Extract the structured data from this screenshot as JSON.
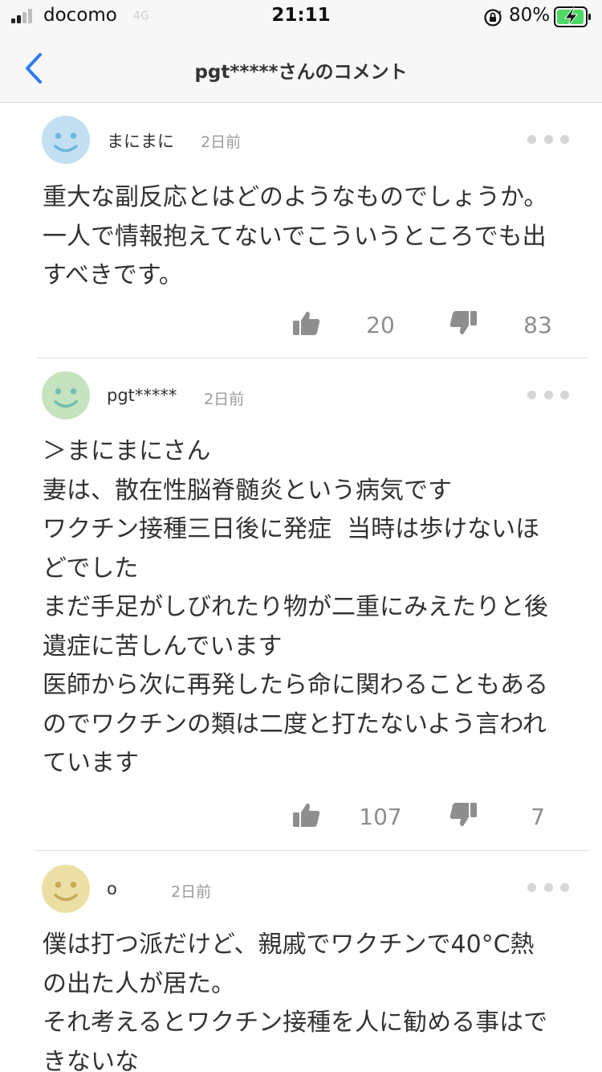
{
  "status_bar": {
    "carrier": "docomo",
    "network": "4G",
    "time": "21:11",
    "battery": "80%"
  },
  "header": {
    "title": "pgt*****さんのコメント",
    "back_icon": "chevron-left-icon",
    "accent_color": "#2e7bf6"
  },
  "comments": [
    {
      "user": "まにまに",
      "time": "2日前",
      "avatar_color": "#c3e0f2",
      "avatar_face_color": "#6fb6de",
      "lines": [
        "重大な副反応とはどのようなものでしょうか。",
        "一人で情報抱えてないでこういうところでも出",
        "すべきです。"
      ],
      "likes": "20",
      "dislikes": "83"
    },
    {
      "user": "pgt*****",
      "time": "2日前",
      "avatar_color": "#c6e3bf",
      "avatar_face_color": "#6fbfb0",
      "lines": [
        "＞まにまにさん",
        "妻は、散在性脳脊髄炎という病気です",
        "ワクチン接種三日後に発症  当時は歩けないほ",
        "どでした",
        "まだ手足がしびれたり物が二重にみえたりと後",
        "遺症に苦しんでいます",
        "医師から次に再発したら命に関わることもある",
        "のでワクチンの類は二度と打たないよう言われ",
        "ています"
      ],
      "likes": "107",
      "dislikes": "7"
    },
    {
      "user": "o",
      "time": "2日前",
      "avatar_color": "#ecdfa6",
      "avatar_face_color": "#c7a95a",
      "lines": [
        "僕は打つ派だけど、親戚でワクチンで40°C熱",
        "の出た人が居た。",
        "それ考えるとワクチン接種を人に勧める事はで",
        "きないな"
      ]
    }
  ],
  "icons": {
    "like": "thumbs-up-icon",
    "dislike": "thumbs-down-icon",
    "more": "more-icon"
  },
  "colors": {
    "icon_gray": "#8e8e8e",
    "battery_green": "#4cd964"
  }
}
